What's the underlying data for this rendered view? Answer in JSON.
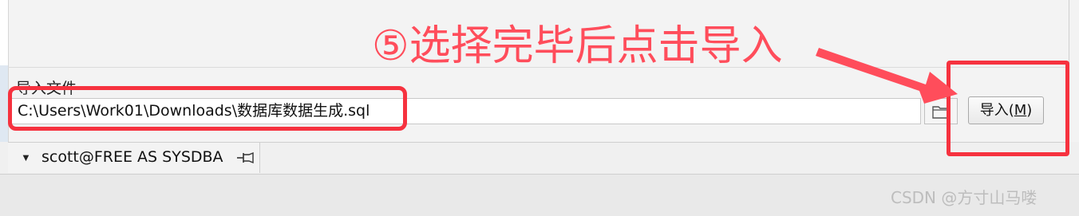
{
  "import_section": {
    "label": "导入文件",
    "file_path": "C:\\Users\\Work01\\Downloads\\数据库数据生成.sql",
    "import_button": {
      "label_prefix": "导入(",
      "mnemonic": "M",
      "label_suffix": ")"
    }
  },
  "session_tab": {
    "label": "scott@FREE AS SYSDBA"
  },
  "annotation": {
    "text": "⑤选择完毕后点击导入",
    "color": "#f6323f"
  },
  "watermark": "CSDN @方寸山马喽",
  "icons": {
    "folder": "folder-icon",
    "pin": "pin-icon",
    "caret": "caret-down-icon"
  }
}
